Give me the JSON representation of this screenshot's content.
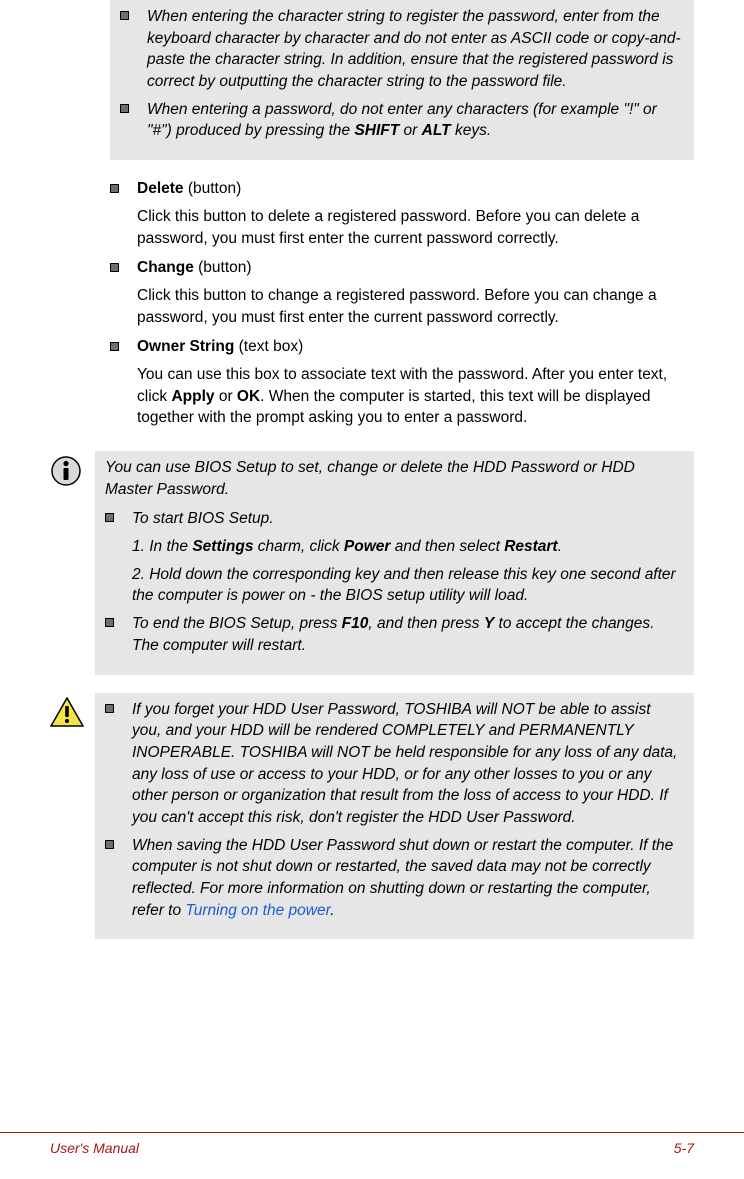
{
  "note_top": {
    "items": [
      {
        "prefix": "When entering the character string to register the password, enter from the keyboard character by character and do not enter as ASCII code or copy-and-paste the character string. In addition, ensure that the registered password is correct by outputting the character string to the password file."
      },
      {
        "prefix": "When entering a password, do not enter any characters (for example \"!\" or \"#\") produced by pressing the ",
        "key1": "SHIFT",
        "mid": " or ",
        "key2": "ALT",
        "suffix": " keys."
      }
    ]
  },
  "body": {
    "items": [
      {
        "title_bold": "Delete",
        "title_rest": " (button)",
        "desc": "Click this button to delete a registered password. Before you can delete a password, you must first enter the current password correctly."
      },
      {
        "title_bold": "Change",
        "title_rest": " (button)",
        "desc": "Click this button to change a registered password. Before you can change a password, you must first enter the current password correctly."
      },
      {
        "title_bold": "Owner String",
        "title_rest": " (text box)",
        "desc_pre": "You can use this box to associate text with the password. After you enter text, click ",
        "desc_b1": "Apply",
        "desc_mid": " or ",
        "desc_b2": "OK",
        "desc_post": ". When the computer is started, this text will be displayed together with the prompt asking you to enter a password."
      }
    ]
  },
  "info_note": {
    "intro": "You can use BIOS Setup to set, change or delete the HDD Password or HDD Master Password.",
    "items": [
      {
        "lead": "To start BIOS Setup.",
        "step1_pre": "1. In the ",
        "step1_b1": "Settings",
        "step1_mid1": " charm, click ",
        "step1_b2": "Power",
        "step1_mid2": " and then select ",
        "step1_b3": "Restart",
        "step1_post": ".",
        "step2": "2. Hold down the corresponding key and then release this key one second after the computer is power on - the BIOS setup utility will load."
      },
      {
        "end_pre": "To end the BIOS Setup, press ",
        "end_b1": "F10",
        "end_mid": ", and then press ",
        "end_b2": "Y",
        "end_post": " to accept the changes. The computer will restart."
      }
    ]
  },
  "warn_note": {
    "items": [
      "If you forget your HDD User Password, TOSHIBA will NOT be able to assist you, and your HDD will be rendered COMPLETELY and PERMANENTLY INOPERABLE. TOSHIBA will NOT be held responsible for any loss of any data, any loss of use or access to your HDD, or for any other losses to you or any other person or organization that result from the loss of access to your HDD. If you can't accept this risk, don't register the HDD User Password.",
      {
        "pre": "When saving the HDD User Password shut down or restart the computer. If the computer is not shut down or restarted, the saved data may not be correctly reflected. For more information on shutting down or restarting the computer, refer to ",
        "link": "Turning on the power",
        "post": "."
      }
    ]
  },
  "footer": {
    "left": "User's Manual",
    "right": "5-7"
  }
}
